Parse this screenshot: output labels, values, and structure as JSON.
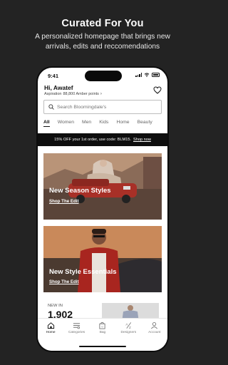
{
  "promo": {
    "title": "Curated For You",
    "subtitle": "A personalized homepage that brings new arrivals, edits and reccomendations"
  },
  "status": {
    "time": "9:41"
  },
  "header": {
    "greeting": "Hi, Awatef",
    "tier": "Aspiration",
    "points": "88,800 Amber points",
    "icons": {
      "wishlist": "heart-icon"
    }
  },
  "search": {
    "placeholder": "Search Bloomingdale's"
  },
  "tabs": [
    "All",
    "Women",
    "Men",
    "Kids",
    "Home",
    "Beauty"
  ],
  "offer": {
    "text": "15% OFF your 1st order, use code: BLM15.",
    "link": "Shop now"
  },
  "cards": [
    {
      "title": "New Season Styles",
      "link": "Shop The Edit"
    },
    {
      "title": "New Style Essentials",
      "link": "Shop The Edit"
    }
  ],
  "new_in": {
    "label": "NEW IN",
    "count": "1,902"
  },
  "bottom_nav": [
    {
      "label": "Home",
      "icon": "home-icon"
    },
    {
      "label": "Categories",
      "icon": "categories-icon"
    },
    {
      "label": "Bag",
      "icon": "bag-icon"
    },
    {
      "label": "Designers",
      "icon": "designers-icon"
    },
    {
      "label": "Account",
      "icon": "account-icon"
    }
  ],
  "colors": {
    "background": "#232323",
    "offer_bar": "#0e0e0e"
  }
}
